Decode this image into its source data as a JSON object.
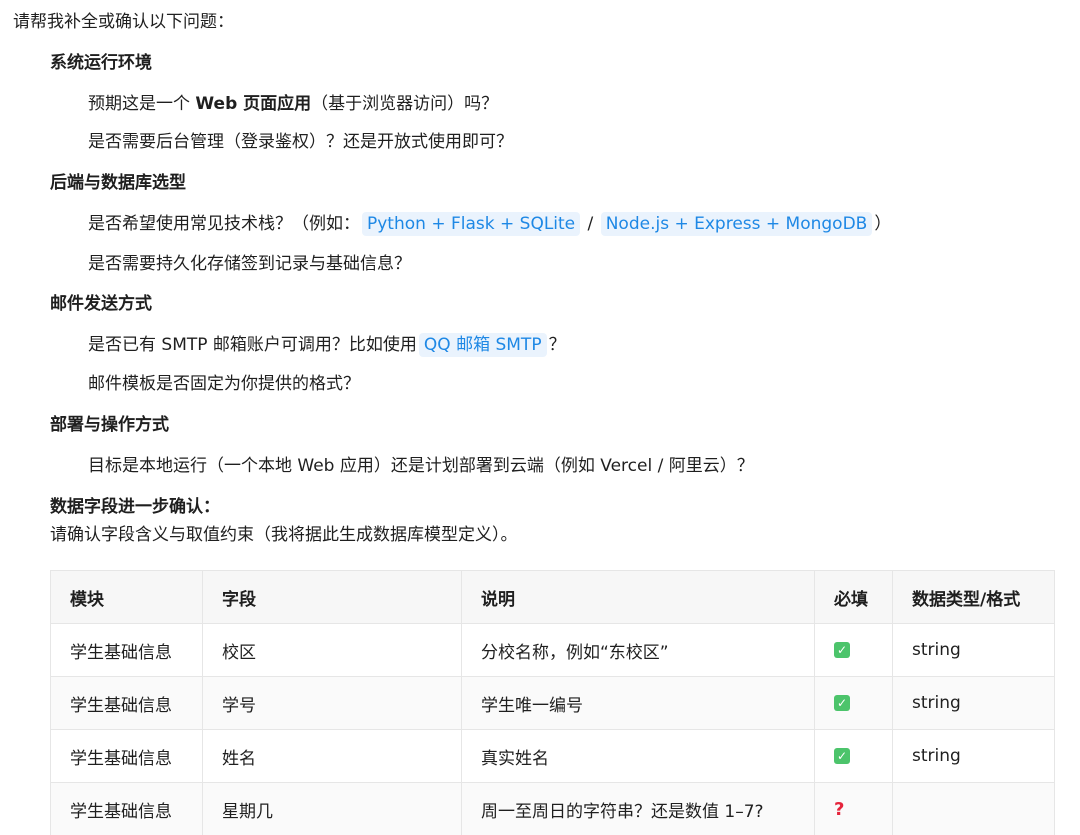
{
  "intro": "请帮我补全或确认以下问题：",
  "sections": [
    {
      "title": "系统运行环境",
      "questions": [
        {
          "pre": "预期这是一个 ",
          "bold": "Web 页面应用",
          "post": "（基于浏览器访问）吗？"
        },
        {
          "text": "是否需要后台管理（登录鉴权）？还是开放式使用即可？"
        }
      ]
    },
    {
      "title": "后端与数据库选型",
      "questions": [
        {
          "pre": "是否希望使用常见技术栈？（例如：",
          "code1": "Python + Flask + SQLite",
          "mid": " / ",
          "code2": "Node.js + Express + MongoDB",
          "post": "）"
        },
        {
          "text": "是否需要持久化存储签到记录与基础信息？"
        }
      ]
    },
    {
      "title": "邮件发送方式",
      "questions": [
        {
          "pre": "是否已有 SMTP 邮箱账户可调用？比如使用",
          "code": "QQ 邮箱 SMTP",
          "post": "？"
        },
        {
          "text": "邮件模板是否固定为你提供的格式？"
        }
      ]
    },
    {
      "title": "部署与操作方式",
      "questions": [
        {
          "text": "目标是本地运行（一个本地 Web 应用）还是计划部署到云端（例如 Vercel / 阿里云）？"
        }
      ]
    }
  ],
  "fields_section": {
    "title": "数据字段进一步确认：",
    "subtitle": "请确认字段含义与取值约束（我将据此生成数据库模型定义）。"
  },
  "table": {
    "headers": [
      "模块",
      "字段",
      "说明",
      "必填",
      "数据类型/格式"
    ],
    "rows": [
      {
        "module": "学生基础信息",
        "field": "校区",
        "desc": "分校名称，例如“东校区”",
        "required": "check",
        "type": "string"
      },
      {
        "module": "学生基础信息",
        "field": "学号",
        "desc": "学生唯一编号",
        "required": "check",
        "type": "string"
      },
      {
        "module": "学生基础信息",
        "field": "姓名",
        "desc": "真实姓名",
        "required": "check",
        "type": "string"
      },
      {
        "module": "学生基础信息",
        "field": "星期几",
        "desc": "周一至周日的字符串？还是数值 1–7?",
        "required": "question",
        "type": ""
      }
    ]
  },
  "icons": {
    "check": "✓",
    "question": "?"
  }
}
